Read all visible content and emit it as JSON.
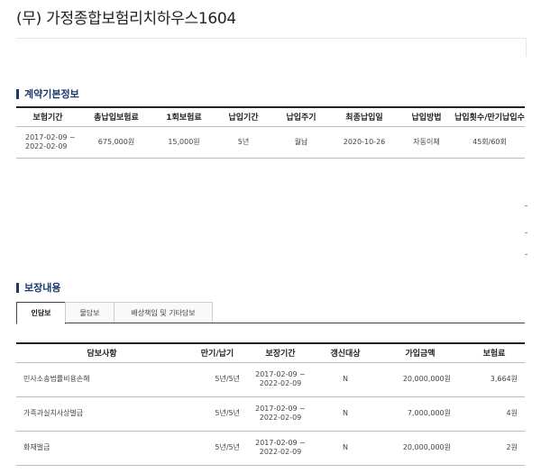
{
  "page": {
    "title": "(무) 가정종합보험리치하우스1604"
  },
  "contract": {
    "heading": "계약기본정보",
    "columns": [
      "보험기간",
      "총납입보험료",
      "1회보험료",
      "납입기간",
      "납입주기",
      "최종납입일",
      "납입방법",
      "납입횟수/만기납입수"
    ],
    "row": {
      "period_start": "2017-02-09 ~",
      "period_end": "2022-02-09",
      "total_premium": "675,000원",
      "per_premium": "15,000원",
      "pay_term": "5년",
      "pay_cycle": "월납",
      "last_paid": "2020-10-26",
      "pay_method": "자동이체",
      "pay_count": "45회/60회"
    }
  },
  "coverage": {
    "heading": "보장내용",
    "tabs": [
      {
        "label": "인담보",
        "active": true
      },
      {
        "label": "물담보",
        "active": false
      },
      {
        "label": "배상책임 및 기타담보",
        "active": false
      }
    ],
    "columns": [
      "담보사항",
      "만기/납기",
      "보장기간",
      "갱신대상",
      "가입금액",
      "보험료"
    ],
    "rows": [
      {
        "name": "민사소송법률비용손해",
        "term": "5년/5년",
        "period_start": "2017-02-09 ~",
        "period_end": "2022-02-09",
        "renewal": "N",
        "amount": "20,000,000원",
        "premium": "3,664원"
      },
      {
        "name": "가족과실치사상벌금",
        "term": "5년/5년",
        "period_start": "2017-02-09 ~",
        "period_end": "2022-02-09",
        "renewal": "N",
        "amount": "7,000,000원",
        "premium": "4원"
      },
      {
        "name": "화재벌금",
        "term": "5년/5년",
        "period_start": "2017-02-09 ~",
        "period_end": "2022-02-09",
        "renewal": "N",
        "amount": "20,000,000원",
        "premium": "2원"
      }
    ]
  },
  "colors": {
    "accent": "#1a3a6c",
    "rule": "#222222"
  }
}
